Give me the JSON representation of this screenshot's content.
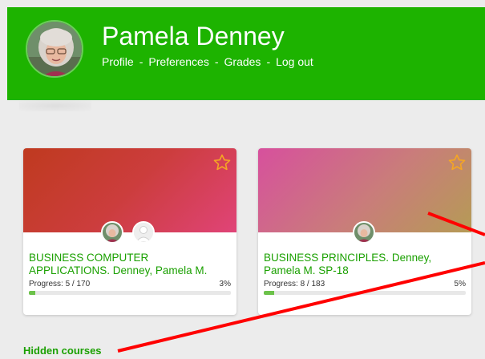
{
  "user": {
    "name": "Pamela Denney",
    "nav": [
      "Profile",
      "Preferences",
      "Grades",
      "Log out"
    ],
    "nav_separator": "-"
  },
  "courses": [
    {
      "title": "BUSINESS COMPUTER APPLICATIONS.",
      "subtitle": "Denney, Pamela M.",
      "progress_label": "Progress: 5 / 170",
      "progress_percent": "3%",
      "progress_value": 3,
      "banner_colors": [
        "#bf3a1f",
        "#e04478"
      ],
      "teachers": [
        "teacher-avatar",
        "placeholder-avatar"
      ],
      "favorite": false
    },
    {
      "title": "BUSINESS PRINCIPLES.",
      "subtitle": "Denney, Pamela M. SP-18",
      "progress_label": "Progress: 8 / 183",
      "progress_percent": "5%",
      "progress_value": 5,
      "banner_colors": [
        "#d7509d",
        "#b59b55"
      ],
      "teachers": [
        "teacher-avatar"
      ],
      "favorite": false
    }
  ],
  "links": {
    "hidden_courses": "Hidden courses"
  },
  "colors": {
    "header": "#1db300",
    "accent": "#1aa000",
    "progress": "#6cc24a",
    "star": "#f5a623",
    "annotation": "#ff0000"
  },
  "icons": {
    "favorite": "star-outline-icon",
    "avatar": "profile-photo"
  }
}
